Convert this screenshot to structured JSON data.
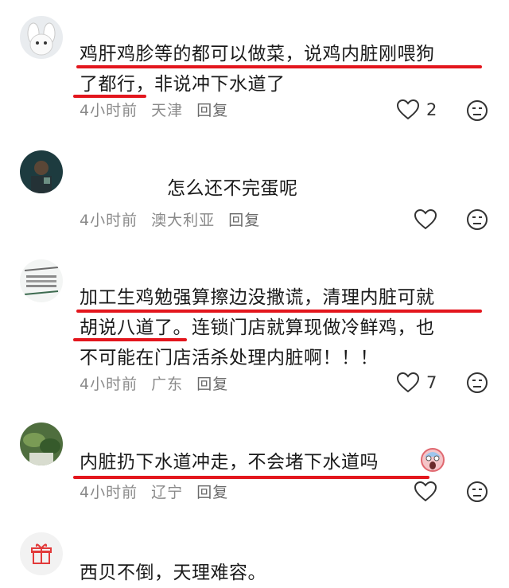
{
  "comments": [
    {
      "lines": [
        "鸡肝鸡胗等的都可以做菜，说鸡内脏刚喂狗",
        "了都行，非说冲下水道了"
      ],
      "time": "4小时前",
      "location": "天津",
      "reply": "回复",
      "likes": "2"
    },
    {
      "lines": [
        "怎么还不完蛋呢"
      ],
      "time": "4小时前",
      "location": "澳大利亚",
      "reply": "回复",
      "likes": ""
    },
    {
      "lines": [
        "加工生鸡勉强算擦边没撒谎，清理内脏可就",
        "胡说八道了。连锁门店就算现做冷鲜鸡，也",
        "不可能在门店活杀处理内脏啊！！！"
      ],
      "time": "4小时前",
      "location": "广东",
      "reply": "回复",
      "likes": "7"
    },
    {
      "lines": [
        "内脏扔下水道冲走，不会堵下水道吗"
      ],
      "time": "4小时前",
      "location": "辽宁",
      "reply": "回复",
      "likes": ""
    },
    {
      "lines": [
        "西贝不倒，天理难容。"
      ]
    }
  ],
  "colors": {
    "highlight": "#e3161d",
    "meta": "#8a8a8a"
  },
  "icons": [
    "heart-icon",
    "dislike-face-icon",
    "screaming-face-emoji",
    "gift-icon"
  ]
}
